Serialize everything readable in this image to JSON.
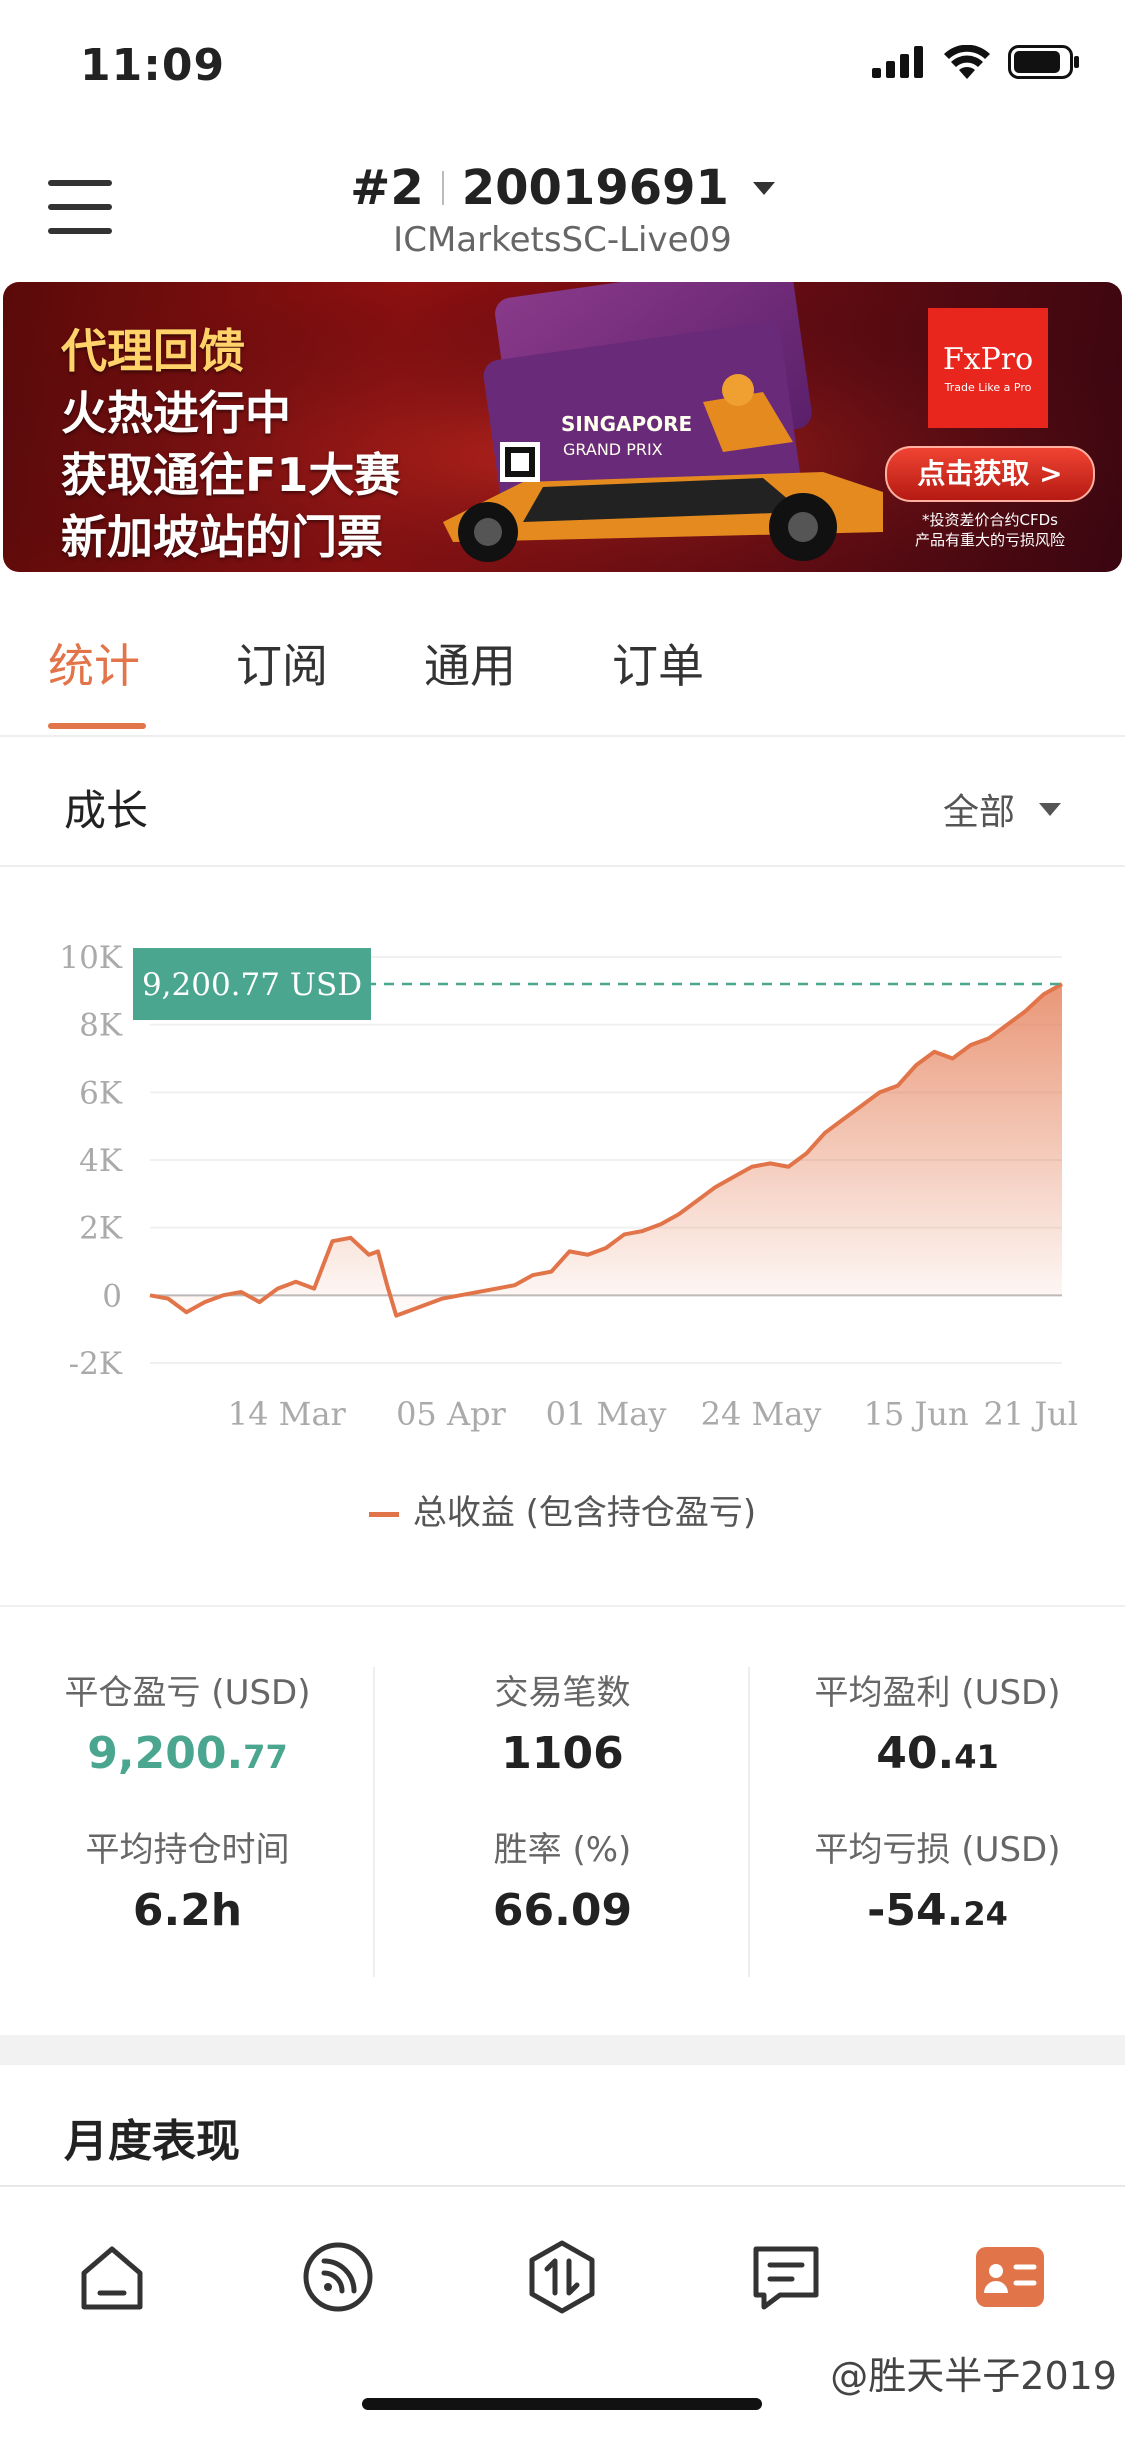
{
  "status_bar": {
    "time": "11:09"
  },
  "header": {
    "account_index": "#2",
    "account_number": "20019691",
    "server": "ICMarketsSC-Live09"
  },
  "banner": {
    "line1": "代理回馈",
    "line2": "火热进行中",
    "line3": "获取通往F1大赛",
    "line4": "新加坡站的门票",
    "brand": "FxPro",
    "brand_tagline": "Trade Like a Pro",
    "cta": "点击获取 >",
    "card_text1": "SINGAPORE",
    "card_text2": "GRAND PRIX",
    "disclaimer1": "*投资差价合约CFDs",
    "disclaimer2": "产品有重大的亏损风险"
  },
  "tabs": [
    {
      "label": "统计",
      "active": true
    },
    {
      "label": "订阅",
      "active": false
    },
    {
      "label": "通用",
      "active": false
    },
    {
      "label": "订单",
      "active": false
    }
  ],
  "growth": {
    "title": "成长",
    "filter": "全部"
  },
  "chart_data": {
    "type": "area",
    "y_ticks": [
      "10K",
      "8K",
      "6K",
      "4K",
      "2K",
      "0",
      "-2K"
    ],
    "x_ticks": [
      "14 Mar",
      "05 Apr",
      "01 May",
      "24 May",
      "15 Jun",
      "21 Jul"
    ],
    "ylim": [
      -2000,
      10000
    ],
    "current_label": "9,200.77 USD",
    "current_value": 9200.77,
    "legend": "总收益 (包含持仓盈亏)",
    "colors": {
      "line": "#e2744a",
      "marker": "#4aa68f"
    },
    "x": [
      0,
      0.02,
      0.04,
      0.06,
      0.08,
      0.1,
      0.12,
      0.14,
      0.16,
      0.18,
      0.2,
      0.22,
      0.24,
      0.25,
      0.26,
      0.27,
      0.28,
      0.29,
      0.3,
      0.31,
      0.32,
      0.34,
      0.36,
      0.38,
      0.4,
      0.42,
      0.44,
      0.46,
      0.48,
      0.5,
      0.52,
      0.54,
      0.56,
      0.58,
      0.6,
      0.62,
      0.64,
      0.66,
      0.68,
      0.7,
      0.72,
      0.74,
      0.76,
      0.78,
      0.8,
      0.82,
      0.84,
      0.86,
      0.88,
      0.9,
      0.92,
      0.94,
      0.96,
      0.98,
      1
    ],
    "values": [
      0,
      -100,
      -500,
      -200,
      0,
      100,
      -200,
      200,
      400,
      200,
      1600,
      1700,
      1200,
      1300,
      300,
      -600,
      -500,
      -400,
      -300,
      -200,
      -100,
      0,
      100,
      200,
      300,
      600,
      700,
      1300,
      1200,
      1400,
      1800,
      1900,
      2100,
      2400,
      2800,
      3200,
      3500,
      3800,
      3900,
      3800,
      4200,
      4800,
      5200,
      5600,
      6000,
      6200,
      6800,
      7200,
      7000,
      7400,
      7600,
      8000,
      8400,
      8900,
      9200.77
    ]
  },
  "stats": {
    "closed_pnl": {
      "label": "平仓盈亏 (USD)",
      "int": "9,200.",
      "dec": "77"
    },
    "trades": {
      "label": "交易笔数",
      "value": "1106"
    },
    "avg_profit": {
      "label": "平均盈利 (USD)",
      "int": "40.",
      "dec": "41"
    },
    "avg_hold": {
      "label": "平均持仓时间",
      "value": "6.2h"
    },
    "win_rate": {
      "label": "胜率 (%)",
      "value": "66.09"
    },
    "avg_loss": {
      "label": "平均亏损 (USD)",
      "int": "-54.",
      "dec": "24"
    }
  },
  "monthly": {
    "title": "月度表现"
  },
  "watermark": "@胜天半子2019"
}
